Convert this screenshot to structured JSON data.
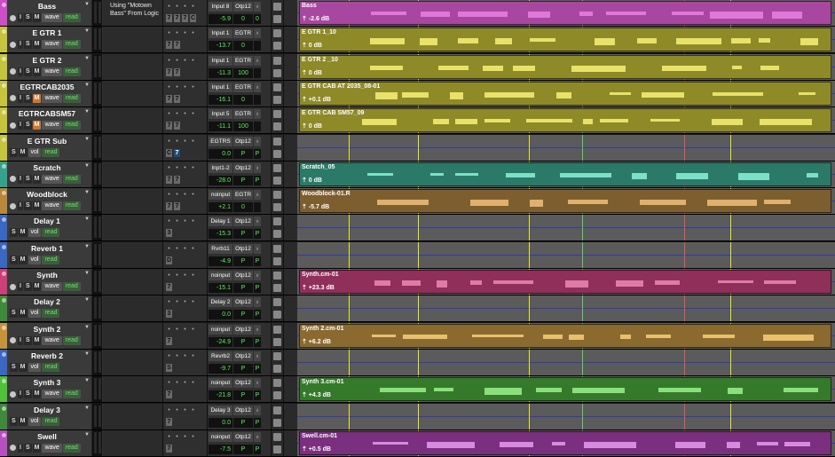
{
  "colors": {
    "marker_yellow": "#e6e62a",
    "marker_red": "#e05a5a",
    "marker_green": "#5fd05f",
    "lane_bg": "#5b5b5b",
    "line_blue": "#2f3aa8"
  },
  "comment_text": "Using \"Motown Bass\" From Logic",
  "markers": [
    {
      "x": 0.095,
      "color": "yellow"
    },
    {
      "x": 0.225,
      "color": "yellow"
    },
    {
      "x": 0.43,
      "color": "yellow"
    },
    {
      "x": 0.53,
      "color": "green"
    },
    {
      "x": 0.72,
      "color": "red"
    },
    {
      "x": 0.805,
      "color": "yellow"
    }
  ],
  "tracks": [
    {
      "name": "Bass",
      "color": "#cc4fc5",
      "rec": true,
      "mute": false,
      "mode": "wave",
      "auto": "read",
      "ins": [
        "7",
        "7",
        "7",
        "C"
      ],
      "input": "Input 8",
      "output": "Otp12",
      "vol": "-5.9",
      "pan": "0",
      "pan2": "0",
      "clip": {
        "name": "Bass",
        "gain": "-2.6 dB",
        "color": "#a8479f",
        "wavecolor": "#e078d8"
      }
    },
    {
      "name": "E GTR 1",
      "color": "#c6c43d",
      "rec": true,
      "mute": false,
      "mode": "wave",
      "auto": "read",
      "ins": [
        "7",
        "7"
      ],
      "input": "Input 1",
      "output": "EGTR",
      "vol": "-13.7",
      "pan": "0",
      "pan2": "",
      "clip": {
        "name": "E GTR 1_10",
        "gain": "0 dB",
        "color": "#8e8a28",
        "wavecolor": "#e8e26a"
      }
    },
    {
      "name": "E GTR 2",
      "color": "#c6c43d",
      "rec": true,
      "mute": false,
      "mode": "wave",
      "auto": "read",
      "ins": [
        "7",
        "7"
      ],
      "input": "Input 1",
      "output": "EGTR",
      "vol": "-11.3",
      "pan": "100",
      "pan2": "",
      "clip": {
        "name": "E GTR 2 _10",
        "gain": "0 dB",
        "color": "#8e8a28",
        "wavecolor": "#e8e26a"
      }
    },
    {
      "name": "EGTRCAB2035",
      "color": "#c6c43d",
      "rec": true,
      "mute": true,
      "mode": "wave",
      "auto": "read",
      "ins": [
        "7",
        "7"
      ],
      "input": "Input 1",
      "output": "EGTR",
      "vol": "-16.1",
      "pan": "0",
      "pan2": "",
      "clip": {
        "name": "E GTR CAB AT 2035_08-01",
        "gain": "+0.1 dB",
        "color": "#8e8a28",
        "wavecolor": "#e8e26a"
      }
    },
    {
      "name": "EGTRCABSM57",
      "color": "#c6c43d",
      "rec": true,
      "mute": true,
      "mode": "wave",
      "auto": "read",
      "ins": [
        "7",
        "7"
      ],
      "input": "Input 5",
      "output": "EGTR",
      "vol": "-11.1",
      "pan": "100",
      "pan2": "",
      "clip": {
        "name": "E GTR CAB SM57_09",
        "gain": "0 dB",
        "color": "#8e8a28",
        "wavecolor": "#e8e26a"
      }
    },
    {
      "name": "E GTR Sub",
      "color": "#c6c43d",
      "rec": false,
      "mute": false,
      "mode": "vol",
      "auto": "read",
      "ins": [
        "C",
        "7"
      ],
      "input": "EGTRS",
      "output": "Otp12",
      "vol": "0.0",
      "pan": "P",
      "pan2": "P",
      "clip": null
    },
    {
      "name": "Scratch",
      "color": "#35a38c",
      "rec": true,
      "mute": false,
      "mode": "wave",
      "auto": "read",
      "ins": [
        "7",
        "7"
      ],
      "input": "Inpt1-2",
      "output": "Otp12",
      "vol": "-28.0",
      "pan": "P",
      "pan2": "P",
      "clip": {
        "name": "Scratch_05",
        "gain": "0 dB",
        "color": "#2b7a68",
        "wavecolor": "#7ee0c6"
      }
    },
    {
      "name": "Woodblock",
      "color": "#b8893c",
      "rec": true,
      "mute": false,
      "mode": "wave",
      "auto": "read",
      "ins": [
        "7",
        "7"
      ],
      "input": "noinput",
      "output": "EGTR",
      "vol": "+2.1",
      "pan": "0",
      "pan2": "",
      "clip": {
        "name": "Woodblock-01.R",
        "gain": "-5.7 dB",
        "color": "#7d5e2e",
        "wavecolor": "#e0b070"
      }
    },
    {
      "name": "Delay 1",
      "color": "#3a66c4",
      "rec": false,
      "mute": false,
      "mode": "vol",
      "auto": "read",
      "ins": [
        "3"
      ],
      "input": "Delay 1",
      "output": "Otp12",
      "vol": "-15.3",
      "pan": "P",
      "pan2": "P",
      "clip": null
    },
    {
      "name": "Reverb 1",
      "color": "#3a66c4",
      "rec": false,
      "mute": false,
      "mode": "vol",
      "auto": "read",
      "ins": [
        "D"
      ],
      "input": "Rvrb11",
      "output": "Otp12",
      "vol": "-4.9",
      "pan": "P",
      "pan2": "P",
      "clip": null
    },
    {
      "name": "Synth",
      "color": "#cc3f7a",
      "rec": true,
      "mute": false,
      "mode": "wave",
      "auto": "read",
      "ins": [
        "7"
      ],
      "input": "noinput",
      "output": "Otp12",
      "vol": "-15.1",
      "pan": "P",
      "pan2": "P",
      "clip": {
        "name": "Synth.cm-01",
        "gain": "+23.3 dB",
        "color": "#8f2f5a",
        "wavecolor": "#e07aa8"
      }
    },
    {
      "name": "Delay 2",
      "color": "#3f8a3a",
      "rec": false,
      "mute": false,
      "mode": "vol",
      "auto": "read",
      "ins": [
        "3"
      ],
      "input": "Delay 2",
      "output": "Otp12",
      "vol": "0.0",
      "pan": "P",
      "pan2": "P",
      "clip": null
    },
    {
      "name": "Synth 2",
      "color": "#c6923a",
      "rec": true,
      "mute": false,
      "mode": "wave",
      "auto": "read",
      "ins": [
        "7"
      ],
      "input": "noinput",
      "output": "Otp12",
      "vol": "-24.9",
      "pan": "P",
      "pan2": "P",
      "clip": {
        "name": "Synth 2.cm-01",
        "gain": "+6.2 dB",
        "color": "#8a6a2e",
        "wavecolor": "#e8c070"
      }
    },
    {
      "name": "Reverb 2",
      "color": "#3a66c4",
      "rec": false,
      "mute": false,
      "mode": "vol",
      "auto": "read",
      "ins": [
        "S"
      ],
      "input": "Revrb2",
      "output": "Otp12",
      "vol": "-9.7",
      "pan": "P",
      "pan2": "P",
      "clip": null
    },
    {
      "name": "Synth 3",
      "color": "#4fc13a",
      "rec": true,
      "mute": false,
      "mode": "wave",
      "auto": "read",
      "ins": [
        "7"
      ],
      "input": "noinput",
      "output": "Otp12",
      "vol": "-21.8",
      "pan": "P",
      "pan2": "P",
      "clip": {
        "name": "Synth 3.cm-01",
        "gain": "+4.3 dB",
        "color": "#357a2b",
        "wavecolor": "#8ae07a"
      }
    },
    {
      "name": "Delay 3",
      "color": "#3f8a3a",
      "rec": false,
      "mute": false,
      "mode": "vol",
      "auto": "read",
      "ins": [
        "7"
      ],
      "input": "Delay 3",
      "output": "Otp12",
      "vol": "0.0",
      "pan": "P",
      "pan2": "P",
      "clip": null
    },
    {
      "name": "Swell",
      "color": "#b84fc0",
      "rec": true,
      "mute": false,
      "mode": "wave",
      "auto": "read",
      "ins": [
        "7"
      ],
      "input": "noinput",
      "output": "Otp12",
      "vol": "-7.5",
      "pan": "P",
      "pan2": "P",
      "clip": {
        "name": "Swell.cm-01",
        "gain": "+0.5 dB",
        "color": "#7a2f7f",
        "wavecolor": "#d88ae0"
      }
    }
  ]
}
